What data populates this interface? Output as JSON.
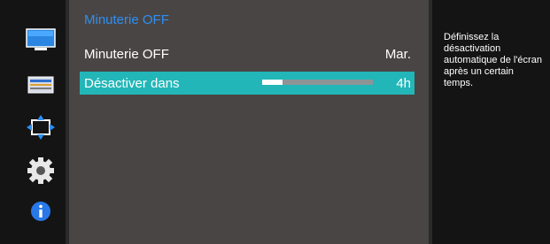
{
  "menu": {
    "title": "Minuterie OFF",
    "items": [
      {
        "label": "Minuterie OFF",
        "value": "Mar."
      },
      {
        "label": "Désactiver dans",
        "value": "4h",
        "level": 0.18
      }
    ]
  },
  "help": {
    "text": "Définissez la désactivation automatique de l'écran après un certain temps."
  },
  "sidebar": {
    "icons": [
      "monitor-icon",
      "picture-settings-icon",
      "position-icon",
      "gear-icon",
      "info-icon"
    ]
  },
  "colors": {
    "highlight": "#23b6b8",
    "title": "#2e8ff0",
    "panel": "#4a4545"
  }
}
